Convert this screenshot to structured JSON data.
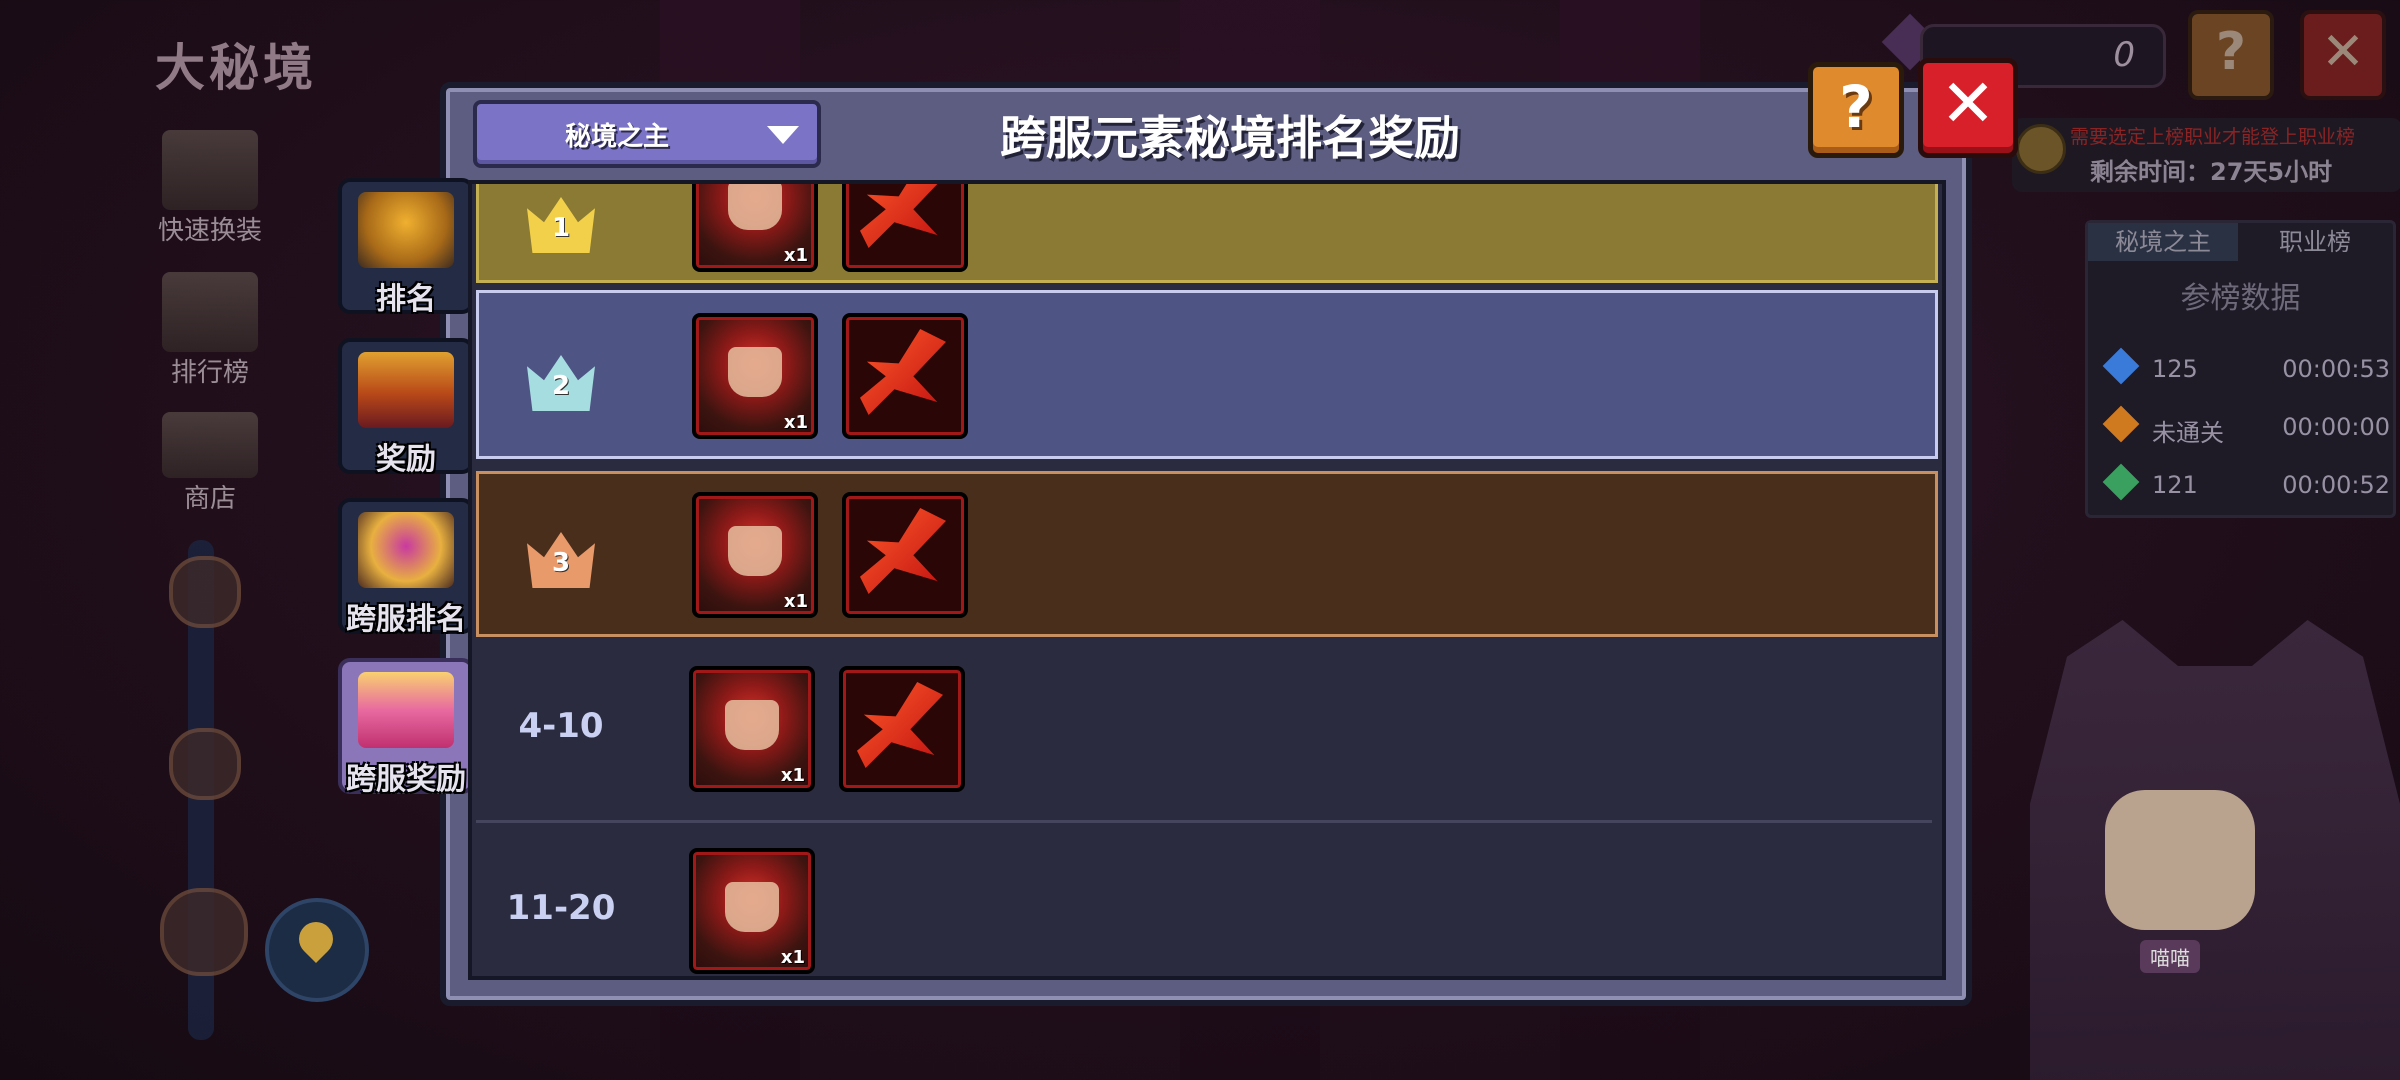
{
  "app": {
    "page_title": "大秘境",
    "currency_value": "0",
    "help_glyph": "?",
    "close_glyph": "✕"
  },
  "bg_menu": {
    "items": [
      {
        "label": "快速换装",
        "icon": "armor-icon"
      },
      {
        "label": "排行榜",
        "icon": "trophy-icon"
      },
      {
        "label": "商店",
        "icon": "shop-icon"
      }
    ]
  },
  "right_panel": {
    "notice": "需要选定上榜职业才能登上职业榜",
    "remaining_time": "剩余时间：27天5小时",
    "tabs": [
      "秘境之主",
      "职业榜"
    ],
    "stats_title": "参榜数据",
    "stats": [
      {
        "value": "125",
        "time": "00:00:53",
        "color": "#3a7ad8"
      },
      {
        "value": "未通关",
        "time": "00:00:00",
        "color": "#d07a20"
      },
      {
        "value": "121",
        "time": "00:00:52",
        "color": "#3aa060"
      }
    ],
    "npc_label": "喵喵"
  },
  "side_tabs": [
    {
      "label": "排名",
      "icon": "trophy-icon",
      "active": false
    },
    {
      "label": "奖励",
      "icon": "chest-icon",
      "active": false
    },
    {
      "label": "跨服排名",
      "icon": "cross-server-trophy-icon",
      "active": false
    },
    {
      "label": "跨服奖励",
      "icon": "cross-server-chest-icon",
      "active": true
    }
  ],
  "modal": {
    "dropdown_value": "秘境之主",
    "title": "跨服元素秘境排名奖励",
    "help_glyph": "?",
    "close_glyph": "✕"
  },
  "rewards": [
    {
      "rank": "1",
      "style": "gold",
      "items": [
        {
          "type": "hero",
          "qty": "x1"
        },
        {
          "type": "weapon",
          "qty": ""
        }
      ]
    },
    {
      "rank": "2",
      "style": "silver",
      "items": [
        {
          "type": "hero",
          "qty": "x1"
        },
        {
          "type": "weapon",
          "qty": ""
        }
      ]
    },
    {
      "rank": "3",
      "style": "bronze",
      "items": [
        {
          "type": "hero",
          "qty": "x1"
        },
        {
          "type": "weapon",
          "qty": ""
        }
      ]
    },
    {
      "rank": "4-10",
      "style": "plain",
      "items": [
        {
          "type": "hero",
          "qty": "x1"
        },
        {
          "type": "weapon",
          "qty": ""
        }
      ]
    },
    {
      "rank": "11-20",
      "style": "plain",
      "items": [
        {
          "type": "hero",
          "qty": "x1"
        }
      ]
    }
  ],
  "colors": {
    "gold_row": "#8a7a34",
    "silver_row": "#4e5584",
    "bronze_row": "#4a2e1c",
    "plain_row": "#2a2b3e",
    "dropdown": "#7b73c6",
    "help_button": "#e08a2e",
    "close_button": "#d8202a"
  }
}
